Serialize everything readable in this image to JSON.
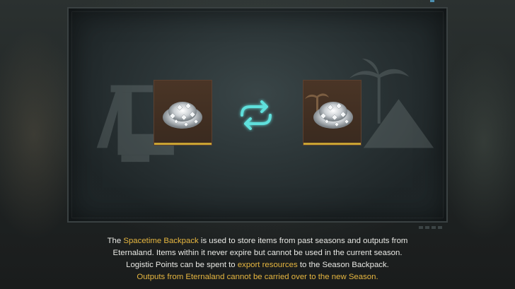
{
  "dialog": {
    "left_item": {
      "icon": "crystal-pile-icon",
      "frame_color": "#c8a232"
    },
    "swap": {
      "icon": "swap-arrows-icon",
      "color": "#5fe0dc"
    },
    "right_item": {
      "icon": "crystal-pile-icon",
      "frame_color": "#c8a232"
    }
  },
  "description": {
    "line1": {
      "before": "The ",
      "highlight": "Spacetime Backpack",
      "after": " is used to store items from past seasons and outputs from"
    },
    "line2": {
      "text": "Eternaland. Items within it never expire but cannot be used in the current season."
    },
    "line3": {
      "before": "Logistic Points can be spent to ",
      "highlight": "export resources",
      "after": " to the Season Backpack."
    },
    "line4": {
      "highlight": "Outputs from Eternaland cannot be carried over to the new Season."
    }
  },
  "colors": {
    "highlight": "#e6b640",
    "body_text": "#e8e8e4"
  }
}
